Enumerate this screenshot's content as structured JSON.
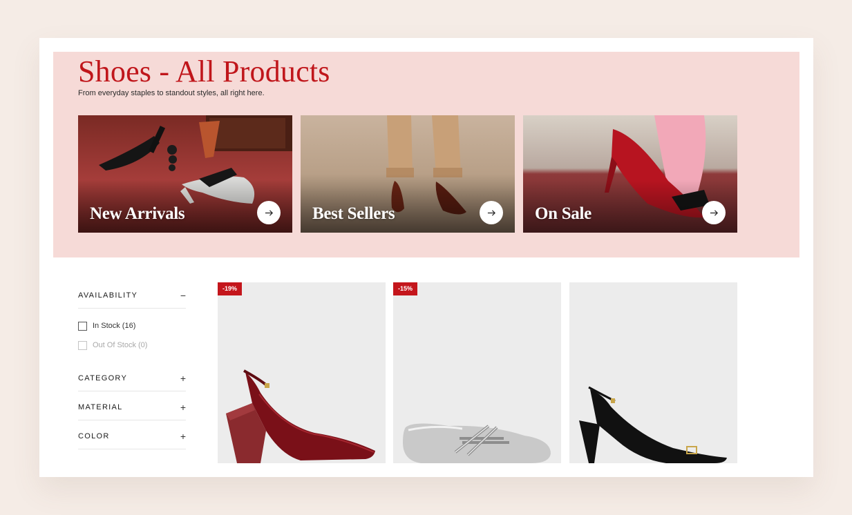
{
  "hero": {
    "title": "Shoes - All Products",
    "subtitle": "From everyday staples to standout styles, all right here.",
    "background": "#f6dad7",
    "title_color": "#c0161b"
  },
  "collections": [
    {
      "label": "New Arrivals",
      "icon": "arrow-right-icon"
    },
    {
      "label": "Best Sellers",
      "icon": "arrow-right-icon"
    },
    {
      "label": "On Sale",
      "icon": "arrow-right-icon"
    }
  ],
  "filters": {
    "availability": {
      "label": "AVAILABILITY",
      "toggle": "−",
      "expanded": true,
      "options": [
        {
          "label": "In Stock (16)",
          "checked": false,
          "disabled": false
        },
        {
          "label": "Out Of Stock (0)",
          "checked": false,
          "disabled": true
        }
      ]
    },
    "category": {
      "label": "CATEGORY",
      "toggle": "+",
      "expanded": false
    },
    "material": {
      "label": "MATERIAL",
      "toggle": "+",
      "expanded": false
    },
    "color": {
      "label": "COLOR",
      "toggle": "+",
      "expanded": false
    }
  },
  "products": [
    {
      "badge": "-19%",
      "image": "burgundy patent slingback wedge pump"
    },
    {
      "badge": "-15%",
      "image": "silver metallic strappy ballet flat"
    },
    {
      "badge": "",
      "image": "black slingback kitten heel pump"
    }
  ],
  "colors": {
    "accent": "#c4161c",
    "page_background": "#f5ece6",
    "product_tile": "#ececec"
  }
}
